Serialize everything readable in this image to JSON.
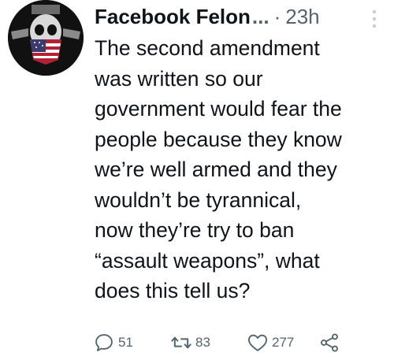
{
  "post": {
    "author": "Facebook Felon",
    "ellipsis": "...",
    "separator": "·",
    "time": "23h",
    "text": "The second amendment\nwas written so our\ngovernment would fear the\npeople because they know\nwe’re well armed and they\nwouldn’t be tyrannical,\nnow they’re try to ban\n“assault weapons”, what\ndoes this tell us?",
    "avatar_icon": "skull-flag-avatar"
  },
  "actions": {
    "replies": "51",
    "retweets": "83",
    "likes": "277",
    "reply_icon": "comment-icon",
    "retweet_icon": "retweet-icon",
    "like_icon": "heart-icon",
    "share_icon": "share-icon"
  },
  "colors": {
    "text": "#0f1419",
    "muted": "#536471",
    "background": "#ffffff"
  }
}
